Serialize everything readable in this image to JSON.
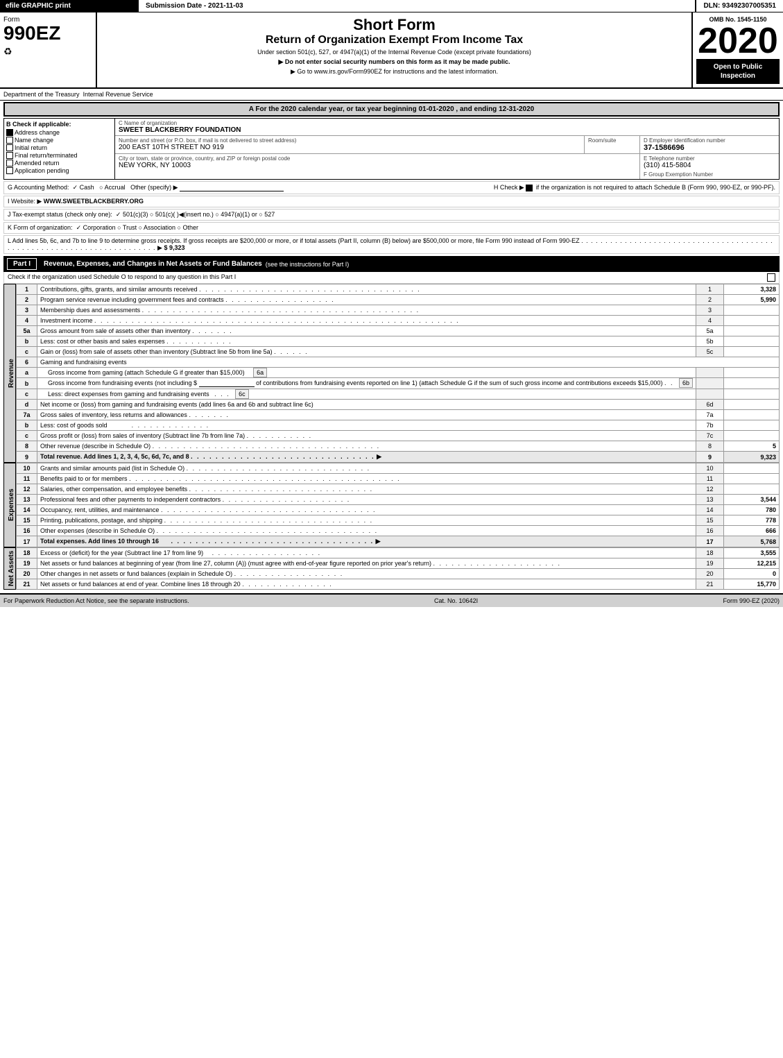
{
  "header": {
    "efile_label": "efile GRAPHIC print",
    "submission_label": "Submission Date - 2021-11-03",
    "dln_label": "DLN: 93492307005351",
    "form_number": "990EZ",
    "form_label": "Form",
    "form_sub": "990EZ",
    "short_form": "Short Form",
    "return_title": "Return of Organization Exempt From Income Tax",
    "under_section": "Under section 501(c), 527, or 4947(a)(1) of the Internal Revenue Code (except private foundations)",
    "no_ssn": "▶ Do not enter social security numbers on this form as it may be made public.",
    "irs_link": "▶ Go to www.irs.gov/Form990EZ for instructions and the latest information.",
    "year": "2020",
    "omb_label": "OMB No. 1545-1150",
    "open_public": "Open to Public Inspection"
  },
  "dept": {
    "label": "Department of the Treasury",
    "irs_label": "Internal Revenue Service"
  },
  "tax_year": {
    "text": "A For the 2020 calendar year, or tax year beginning 01-01-2020 , and ending 12-31-2020"
  },
  "check_if_applicable": {
    "label": "B Check if applicable:",
    "items": [
      {
        "id": "address_change",
        "label": "Address change",
        "checked": true
      },
      {
        "id": "name_change",
        "label": "Name change",
        "checked": false
      },
      {
        "id": "initial_return",
        "label": "Initial return",
        "checked": false
      },
      {
        "id": "final_return",
        "label": "Final return/terminated",
        "checked": false
      },
      {
        "id": "amended_return",
        "label": "Amended return",
        "checked": false
      },
      {
        "id": "application_pending",
        "label": "Application pending",
        "checked": false
      }
    ]
  },
  "org": {
    "name_label": "C Name of organization",
    "name": "SWEET BLACKBERRY FOUNDATION",
    "address_label": "Number and street (or P.O. box, if mail is not delivered to street address)",
    "address": "200 EAST 10TH STREET NO 919",
    "room_label": "Room/suite",
    "room": "",
    "city_label": "City or town, state or province, country, and ZIP or foreign postal code",
    "city": "NEW YORK, NY  10003",
    "ein_label": "D Employer identification number",
    "ein": "37-1586696",
    "phone_label": "E Telephone number",
    "phone": "(310) 415-5804",
    "group_label": "F Group Exemption Number",
    "group": ""
  },
  "accounting": {
    "label": "G Accounting Method:",
    "cash_label": "✓ Cash",
    "accrual_label": "○ Accrual",
    "other_label": "Other (specify) ▶",
    "h_label": "H Check ▶",
    "h_checked": true,
    "h_text": "if the organization is not required to attach Schedule B (Form 990, 990-EZ, or 990-PF)."
  },
  "website": {
    "label": "I Website: ▶",
    "url": "WWW.SWEETBLACKBERRY.ORG"
  },
  "tax_exempt": {
    "label": "J Tax-exempt status (check only one):",
    "options": "✓ 501(c)(3)  ○ 501(c)(   )◀(insert no.)  ○ 4947(a)(1) or  ○ 527"
  },
  "form_org": {
    "label": "K Form of organization:",
    "options": "✓ Corporation  ○ Trust  ○ Association  ○ Other"
  },
  "add_lines": {
    "text": "L Add lines 5b, 6c, and 7b to line 9 to determine gross receipts. If gross receipts are $200,000 or more, or if total assets (Part II, column (B) below) are $500,000 or more, file Form 990 instead of Form 990-EZ",
    "dots": " . . . . . . . . . . . . . . . . . . . . . . . . . . . . . . . . . . . . . . . . . . . . . . . . . . . . . . . . . . . . . . . . . . . . . . .",
    "arrow": "▶",
    "amount": "$ 9,323"
  },
  "part1": {
    "label": "Part I",
    "title": "Revenue, Expenses, and Changes in Net Assets or Fund Balances",
    "subtitle": "(see the instructions for Part I)",
    "check_schedule_o": "Check if the organization used Schedule O to respond to any question in this Part I",
    "rows": [
      {
        "num": "1",
        "desc": "Contributions, gifts, grants, and similar amounts received",
        "dots": true,
        "line_ref": "1",
        "amount": "3,328"
      },
      {
        "num": "2",
        "desc": "Program service revenue including government fees and contracts",
        "dots": true,
        "line_ref": "2",
        "amount": "5,990"
      },
      {
        "num": "3",
        "desc": "Membership dues and assessments",
        "dots": true,
        "line_ref": "3",
        "amount": ""
      },
      {
        "num": "4",
        "desc": "Investment income",
        "dots": true,
        "line_ref": "4",
        "amount": ""
      },
      {
        "num": "5a",
        "desc": "Gross amount from sale of assets other than inventory",
        "dots7": true,
        "sub_ref": "5a",
        "amount": ""
      },
      {
        "num": "5b",
        "desc": "Less: cost or other basis and sales expenses",
        "dots": true,
        "sub_ref": "5b",
        "amount": ""
      },
      {
        "num": "5c",
        "desc": "Gain or (loss) from sale of assets other than inventory (Subtract line 5b from line 5a)",
        "dots": true,
        "line_ref": "5c",
        "amount": ""
      },
      {
        "num": "6",
        "desc": "Gaming and fundraising events",
        "dots": false,
        "line_ref": "",
        "amount": ""
      },
      {
        "num": "6a",
        "sub": true,
        "desc": "Gross income from gaming (attach Schedule G if greater than $15,000)",
        "sub_ref": "6a",
        "amount": ""
      },
      {
        "num": "6b",
        "sub": true,
        "desc": "Gross income from fundraising events (not including $_____ of contributions from fundraising events reported on line 1) (attach Schedule G if the sum of such gross income and contributions exceeds $15,000)",
        "sub_ref": "6b",
        "amount": ""
      },
      {
        "num": "6c",
        "sub": true,
        "desc": "Less: direct expenses from gaming and fundraising events",
        "sub_ref": "6c",
        "amount": ""
      },
      {
        "num": "6d",
        "desc": "Net income or (loss) from gaming and fundraising events (add lines 6a and 6b and subtract line 6c)",
        "line_ref": "6d",
        "amount": ""
      },
      {
        "num": "7a",
        "desc": "Gross sales of inventory, less returns and allowances",
        "dots": true,
        "sub_ref": "7a",
        "amount": ""
      },
      {
        "num": "7b",
        "desc": "Less: cost of goods sold",
        "dots": true,
        "sub_ref": "7b",
        "amount": ""
      },
      {
        "num": "7c",
        "desc": "Gross profit or (loss) from sales of inventory (Subtract line 7b from line 7a)",
        "dots": true,
        "line_ref": "7c",
        "amount": ""
      },
      {
        "num": "8",
        "desc": "Other revenue (describe in Schedule O)",
        "dots": true,
        "line_ref": "8",
        "amount": "5"
      },
      {
        "num": "9",
        "desc": "Total revenue. Add lines 1, 2, 3, 4, 5c, 6d, 7c, and 8",
        "dots": true,
        "line_ref": "9",
        "amount": "9,323",
        "bold": true,
        "arrow": true
      }
    ],
    "revenue_label": "Revenue"
  },
  "expenses": {
    "label": "Expenses",
    "rows": [
      {
        "num": "10",
        "desc": "Grants and similar amounts paid (list in Schedule O)",
        "dots": true,
        "line_ref": "10",
        "amount": ""
      },
      {
        "num": "11",
        "desc": "Benefits paid to or for members",
        "dots": true,
        "line_ref": "11",
        "amount": ""
      },
      {
        "num": "12",
        "desc": "Salaries, other compensation, and employee benefits",
        "dots": true,
        "line_ref": "12",
        "amount": ""
      },
      {
        "num": "13",
        "desc": "Professional fees and other payments to independent contractors",
        "dots": true,
        "line_ref": "13",
        "amount": "3,544"
      },
      {
        "num": "14",
        "desc": "Occupancy, rent, utilities, and maintenance",
        "dots": true,
        "line_ref": "14",
        "amount": "780"
      },
      {
        "num": "15",
        "desc": "Printing, publications, postage, and shipping",
        "dots": true,
        "line_ref": "15",
        "amount": "778"
      },
      {
        "num": "16",
        "desc": "Other expenses (describe in Schedule O)",
        "dots": true,
        "line_ref": "16",
        "amount": "666"
      },
      {
        "num": "17",
        "desc": "Total expenses. Add lines 10 through 16",
        "dots": true,
        "line_ref": "17",
        "amount": "5,768",
        "bold": true,
        "arrow": true
      }
    ]
  },
  "net_assets": {
    "label": "Net Assets",
    "rows": [
      {
        "num": "18",
        "desc": "Excess or (deficit) for the year (Subtract line 17 from line 9)",
        "dots": true,
        "line_ref": "18",
        "amount": "3,555"
      },
      {
        "num": "19",
        "desc": "Net assets or fund balances at beginning of year (from line 27, column (A)) (must agree with end-of-year figure reported on prior year's return)",
        "dots": true,
        "line_ref": "19",
        "amount": "12,215"
      },
      {
        "num": "20",
        "desc": "Other changes in net assets or fund balances (explain in Schedule O)",
        "dots": true,
        "line_ref": "20",
        "amount": "0"
      },
      {
        "num": "21",
        "desc": "Net assets or fund balances at end of year. Combine lines 18 through 20",
        "dots": true,
        "line_ref": "21",
        "amount": "15,770"
      }
    ]
  },
  "footer": {
    "paperwork_text": "For Paperwork Reduction Act Notice, see the separate instructions.",
    "cat_no": "Cat. No. 10642I",
    "form_label": "Form 990-EZ (2020)"
  }
}
